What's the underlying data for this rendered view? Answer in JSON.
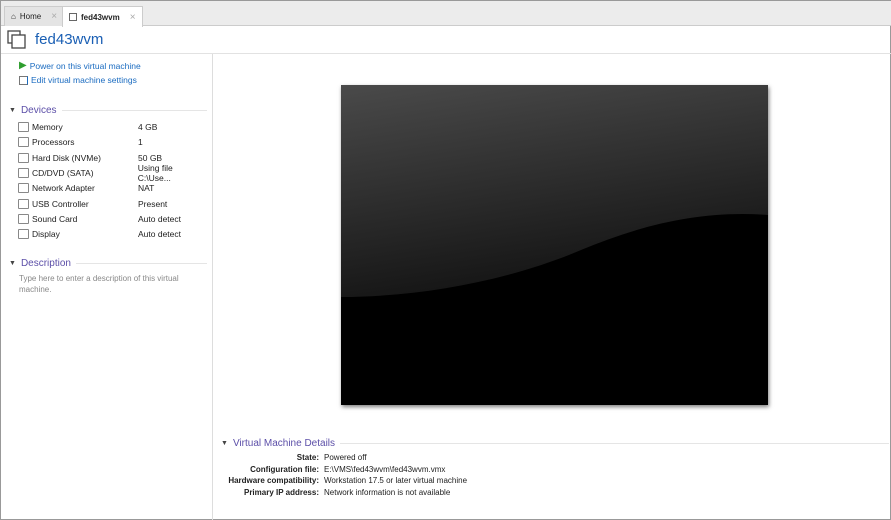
{
  "tabs": [
    {
      "label": "Home",
      "icon": "home-icon"
    },
    {
      "label": "fed43wvm",
      "icon": "vm-icon",
      "active": true
    }
  ],
  "header": {
    "title": "fed43wvm"
  },
  "actions": [
    {
      "label": "Power on this virtual machine",
      "icon": "play-icon",
      "color": "#2e9e2e"
    },
    {
      "label": "Edit virtual machine settings",
      "icon": "settings-icon"
    }
  ],
  "devices": {
    "title": "Devices",
    "items": [
      {
        "name": "Memory",
        "value": "4 GB",
        "icon": "memory-icon"
      },
      {
        "name": "Processors",
        "value": "1",
        "icon": "processor-icon"
      },
      {
        "name": "Hard Disk (NVMe)",
        "value": "50 GB",
        "icon": "hard-disk-icon"
      },
      {
        "name": "CD/DVD (SATA)",
        "value": "Using file C:\\Use...",
        "icon": "cd-dvd-icon"
      },
      {
        "name": "Network Adapter",
        "value": "NAT",
        "icon": "network-icon"
      },
      {
        "name": "USB Controller",
        "value": "Present",
        "icon": "usb-icon"
      },
      {
        "name": "Sound Card",
        "value": "Auto detect",
        "icon": "sound-icon"
      },
      {
        "name": "Display",
        "value": "Auto detect",
        "icon": "display-icon"
      }
    ]
  },
  "description": {
    "title": "Description",
    "placeholder": "Type here to enter a description of this virtual machine."
  },
  "details": {
    "title": "Virtual Machine Details",
    "rows": [
      {
        "key": "State:",
        "value": "Powered off"
      },
      {
        "key": "Configuration file:",
        "value": "E:\\VMS\\fed43wvm\\fed43wvm.vmx"
      },
      {
        "key": "Hardware compatibility:",
        "value": "Workstation 17.5 or later virtual machine"
      },
      {
        "key": "Primary IP address:",
        "value": "Network information is not available"
      }
    ]
  }
}
